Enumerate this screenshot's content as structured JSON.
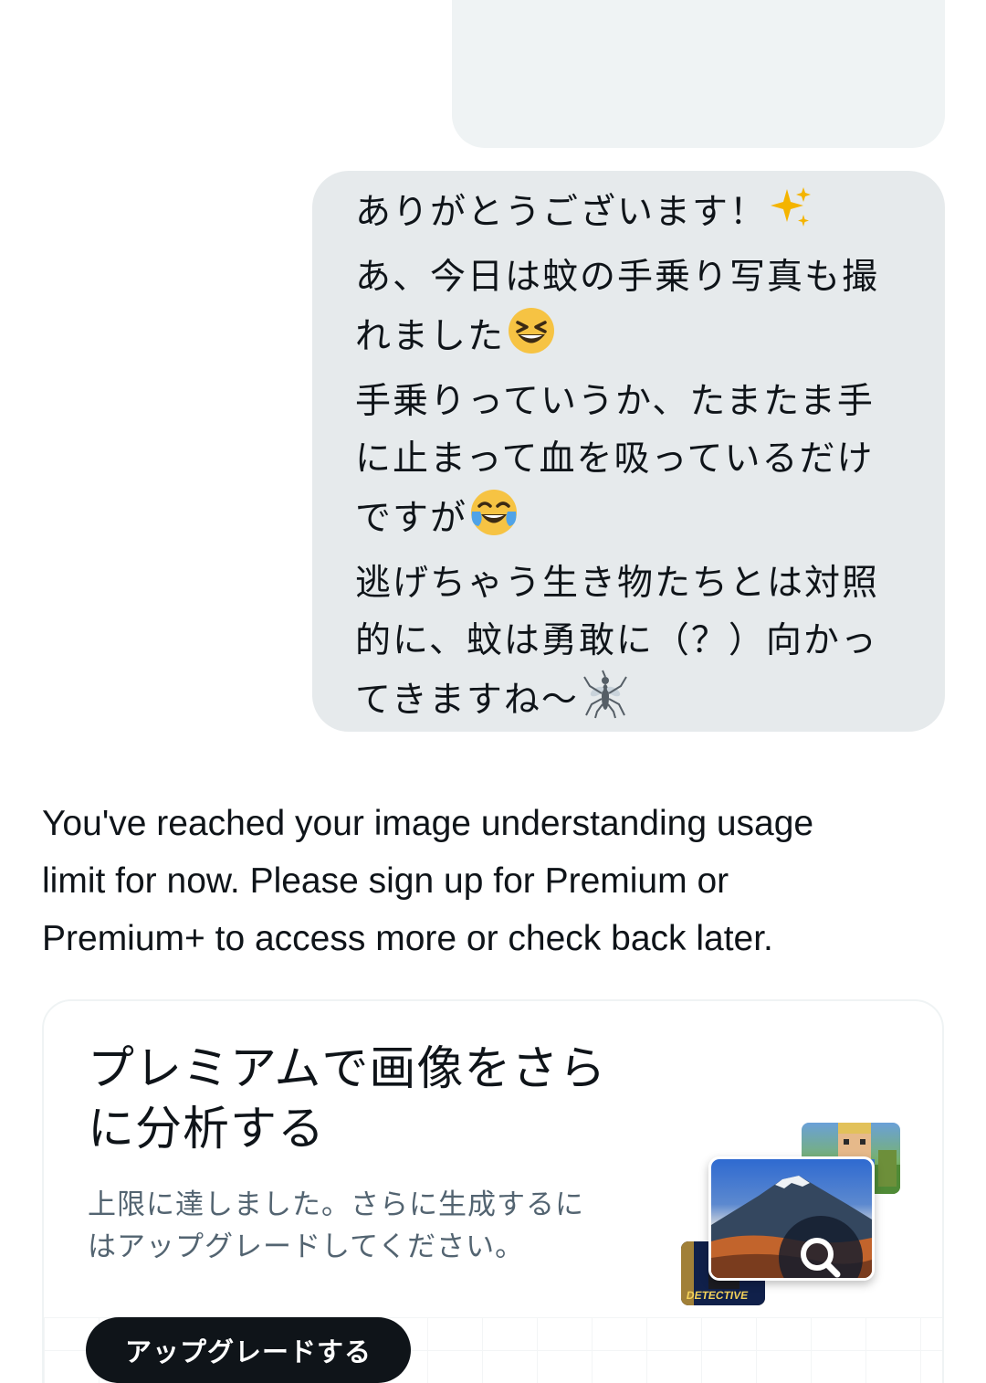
{
  "user_message": {
    "lines": [
      "ありがとうございます！",
      "あ、今日は蚊の手乗り写真も撮",
      "れました",
      "手乗りっていうか、たまたま手",
      "に止まって血を吸っているだけ",
      "ですが",
      "逃げちゃう生き物たちとは対照",
      "的に、蚊は勇敢に（？）向かっ",
      "てきますね〜"
    ],
    "emojis": {
      "line_1": "sparkles-emoji",
      "line_3": "grinning-squinting-face-emoji",
      "line_6": "face-with-tears-of-joy-emoji",
      "line_9": "mosquito-emoji"
    }
  },
  "system_message": {
    "lines": [
      "You've reached your image understanding usage",
      "limit for now. Please sign up for Premium or",
      "Premium+ to access more or check back later."
    ]
  },
  "premium_card": {
    "title_lines": [
      "プレミアムで画像をさら",
      "に分析する"
    ],
    "subtitle_lines": [
      "上限に達しました。さらに生成するに",
      "はアップグレードしてください。"
    ],
    "button_label": "アップグレードする",
    "illustration": {
      "thumbnail_label": "DETECTIVE",
      "icon": "search-icon"
    }
  },
  "colors": {
    "user_bubble": "#e6eaec",
    "prev_bubble": "#eff3f4",
    "text": "#0f1419",
    "subtitle": "#536471",
    "button_bg": "#0f1419",
    "button_text": "#ffffff"
  }
}
